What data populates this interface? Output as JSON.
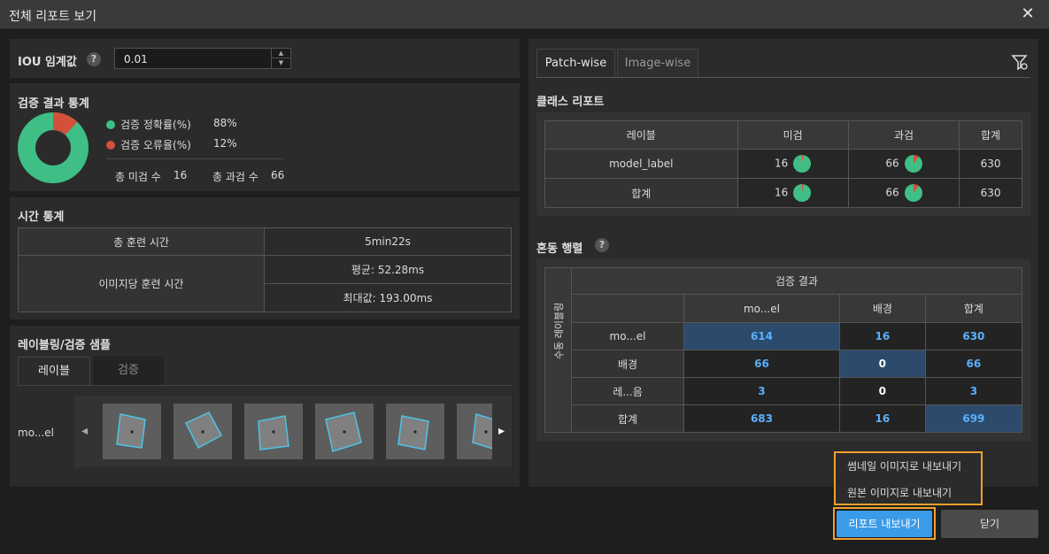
{
  "window": {
    "title": "전체 리포트 보기"
  },
  "iou": {
    "label": "IOU 임계값",
    "help": "?",
    "value": "0.01"
  },
  "stats": {
    "title": "검증 결과 통계",
    "accuracy_label": "검증 정확률(%)",
    "accuracy_value": "88%",
    "error_label": "검증 오류율(%)",
    "error_value": "12%",
    "miss_label": "총 미검 수",
    "miss_value": "16",
    "over_label": "총 과검 수",
    "over_value": "66",
    "colors": {
      "accuracy": "#3fbf85",
      "error": "#d2503c"
    },
    "accuracy_fraction": 0.88
  },
  "time": {
    "title": "시간 통계",
    "total_label": "총 훈련 시간",
    "total_value": "5min22s",
    "per_image_label": "이미지당 훈련 시간",
    "avg_value": "평균: 52.28ms",
    "max_value": "최대값: 193.00ms"
  },
  "samples": {
    "title": "레이블링/검증 샘플",
    "tabs": [
      "레이블",
      "검증"
    ],
    "row_label": "mo...el",
    "prev": "◂",
    "next": "▸",
    "thumb_count": 6
  },
  "report": {
    "tabs": [
      "Patch-wise",
      "Image-wise"
    ],
    "class_title": "클래스 리포트",
    "class_headers": [
      "레이블",
      "미검",
      "과검",
      "합계"
    ],
    "class_rows": [
      {
        "label": "model_label",
        "miss": "16",
        "over": "66",
        "total": "630"
      },
      {
        "label": "합계",
        "miss": "16",
        "over": "66",
        "total": "630"
      }
    ],
    "confusion_title": "혼동 행렬",
    "confusion_help": "?",
    "result_header": "검증 결과",
    "side_header": "수동 레이블링",
    "col_headers": [
      "mo...el",
      "배경",
      "합계"
    ],
    "rows": [
      {
        "label": "mo...el",
        "cells": [
          "614",
          "16",
          "630"
        ]
      },
      {
        "label": "배경",
        "cells": [
          "66",
          "0",
          "66"
        ]
      },
      {
        "label": "레...음",
        "cells": [
          "3",
          "0",
          "3"
        ]
      },
      {
        "label": "합계",
        "cells": [
          "683",
          "16",
          "699"
        ]
      }
    ]
  },
  "export_menu": {
    "items": [
      "썸네일 이미지로 내보내기",
      "원본 이미지로 내보내기"
    ]
  },
  "buttons": {
    "export": "리포트 내보내기",
    "close": "닫기"
  }
}
